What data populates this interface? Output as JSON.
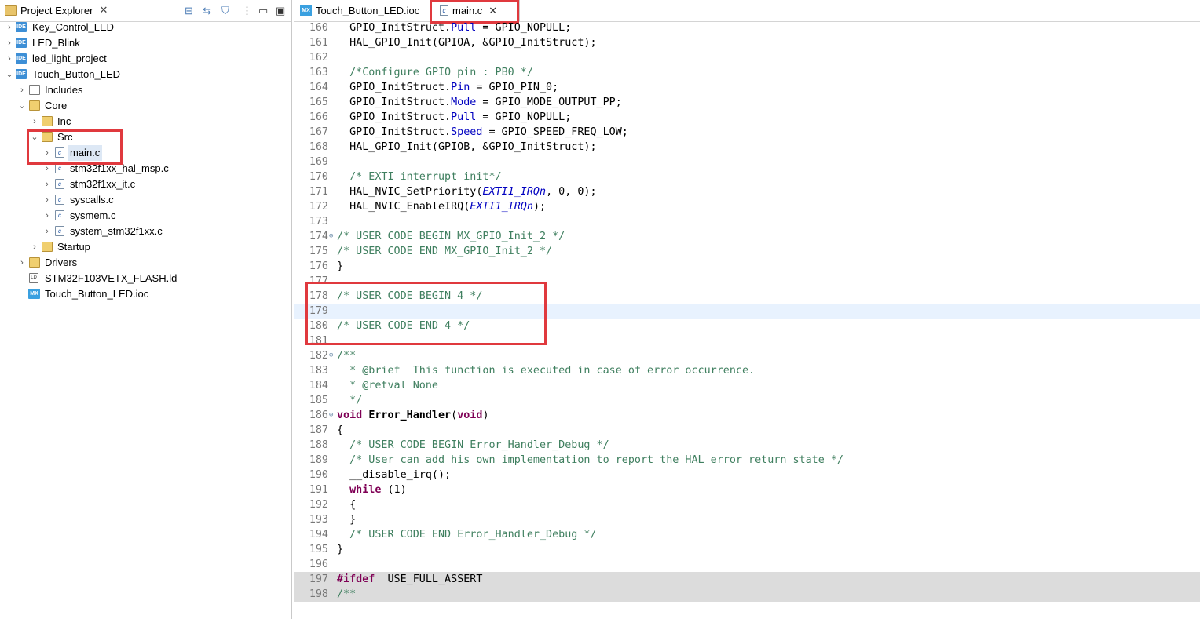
{
  "project_explorer": {
    "title": "Project Explorer",
    "toolbar_icons": [
      "collapse-all-icon",
      "link-with-editor-icon",
      "filter-icon",
      "view-menu-icon",
      "minimize-icon",
      "maximize-icon"
    ],
    "items": [
      {
        "label": "Key_Control_LED",
        "icon": "ide-project-icon",
        "expanded": false
      },
      {
        "label": "LED_Blink",
        "icon": "ide-project-icon",
        "expanded": false
      },
      {
        "label": "led_light_project",
        "icon": "ide-project-icon",
        "expanded": false
      },
      {
        "label": "Touch_Button_LED",
        "icon": "ide-project-icon",
        "expanded": true
      },
      {
        "label": "Includes",
        "icon": "includes-icon",
        "expanded": false
      },
      {
        "label": "Core",
        "icon": "folder-icon",
        "expanded": true
      },
      {
        "label": "Inc",
        "icon": "folder-icon",
        "expanded": false
      },
      {
        "label": "Src",
        "icon": "folder-icon",
        "expanded": true
      },
      {
        "label": "main.c",
        "icon": "c-file-icon",
        "selected": true
      },
      {
        "label": "stm32f1xx_hal_msp.c",
        "icon": "c-file-icon"
      },
      {
        "label": "stm32f1xx_it.c",
        "icon": "c-file-icon"
      },
      {
        "label": "syscalls.c",
        "icon": "c-file-icon"
      },
      {
        "label": "sysmem.c",
        "icon": "c-file-icon"
      },
      {
        "label": "system_stm32f1xx.c",
        "icon": "c-file-icon"
      },
      {
        "label": "Startup",
        "icon": "folder-icon",
        "expanded": false
      },
      {
        "label": "Drivers",
        "icon": "folder-icon",
        "expanded": false
      },
      {
        "label": "STM32F103VETX_FLASH.ld",
        "icon": "linker-file-icon"
      },
      {
        "label": "Touch_Button_LED.ioc",
        "icon": "mx-file-icon"
      }
    ]
  },
  "editor": {
    "tabs": [
      {
        "label": "Touch_Button_LED.ioc",
        "icon_text": "MX",
        "active": false
      },
      {
        "label": "main.c",
        "icon_text": "c",
        "active": true
      }
    ],
    "lines": [
      {
        "n": "160",
        "text": "  GPIO_InitStruct.Pull = GPIO_NOPULL;"
      },
      {
        "n": "161",
        "text": "  HAL_GPIO_Init(GPIOA, &GPIO_InitStruct);"
      },
      {
        "n": "162",
        "text": ""
      },
      {
        "n": "163",
        "text": "  /*Configure GPIO pin : PB0 */"
      },
      {
        "n": "164",
        "text": "  GPIO_InitStruct.Pin = GPIO_PIN_0;"
      },
      {
        "n": "165",
        "text": "  GPIO_InitStruct.Mode = GPIO_MODE_OUTPUT_PP;"
      },
      {
        "n": "166",
        "text": "  GPIO_InitStruct.Pull = GPIO_NOPULL;"
      },
      {
        "n": "167",
        "text": "  GPIO_InitStruct.Speed = GPIO_SPEED_FREQ_LOW;"
      },
      {
        "n": "168",
        "text": "  HAL_GPIO_Init(GPIOB, &GPIO_InitStruct);"
      },
      {
        "n": "169",
        "text": ""
      },
      {
        "n": "170",
        "text": "  /* EXTI interrupt init*/"
      },
      {
        "n": "171",
        "text": "  HAL_NVIC_SetPriority(EXTI1_IRQn, 0, 0);"
      },
      {
        "n": "172",
        "text": "  HAL_NVIC_EnableIRQ(EXTI1_IRQn);"
      },
      {
        "n": "173",
        "text": ""
      },
      {
        "n": "174",
        "text": "/* USER CODE BEGIN MX_GPIO_Init_2 */"
      },
      {
        "n": "175",
        "text": "/* USER CODE END MX_GPIO_Init_2 */"
      },
      {
        "n": "176",
        "text": "}"
      },
      {
        "n": "177",
        "text": ""
      },
      {
        "n": "178",
        "text": "/* USER CODE BEGIN 4 */"
      },
      {
        "n": "179",
        "text": ""
      },
      {
        "n": "180",
        "text": "/* USER CODE END 4 */"
      },
      {
        "n": "181",
        "text": ""
      },
      {
        "n": "182",
        "text": "/**"
      },
      {
        "n": "183",
        "text": "  * @brief  This function is executed in case of error occurrence."
      },
      {
        "n": "184",
        "text": "  * @retval None"
      },
      {
        "n": "185",
        "text": "  */"
      },
      {
        "n": "186",
        "text": "void Error_Handler(void)"
      },
      {
        "n": "187",
        "text": "{"
      },
      {
        "n": "188",
        "text": "  /* USER CODE BEGIN Error_Handler_Debug */"
      },
      {
        "n": "189",
        "text": "  /* User can add his own implementation to report the HAL error return state */"
      },
      {
        "n": "190",
        "text": "  __disable_irq();"
      },
      {
        "n": "191",
        "text": "  while (1)"
      },
      {
        "n": "192",
        "text": "  {"
      },
      {
        "n": "193",
        "text": "  }"
      },
      {
        "n": "194",
        "text": "  /* USER CODE END Error_Handler_Debug */"
      },
      {
        "n": "195",
        "text": "}"
      },
      {
        "n": "196",
        "text": ""
      },
      {
        "n": "197",
        "text": "#ifdef  USE_FULL_ASSERT"
      },
      {
        "n": "198",
        "text": "/**"
      }
    ]
  },
  "colors": {
    "highlight_box": "#e0393e",
    "comment": "#3f7f5f",
    "keyword": "#7f0055",
    "field": "#0000c0"
  }
}
